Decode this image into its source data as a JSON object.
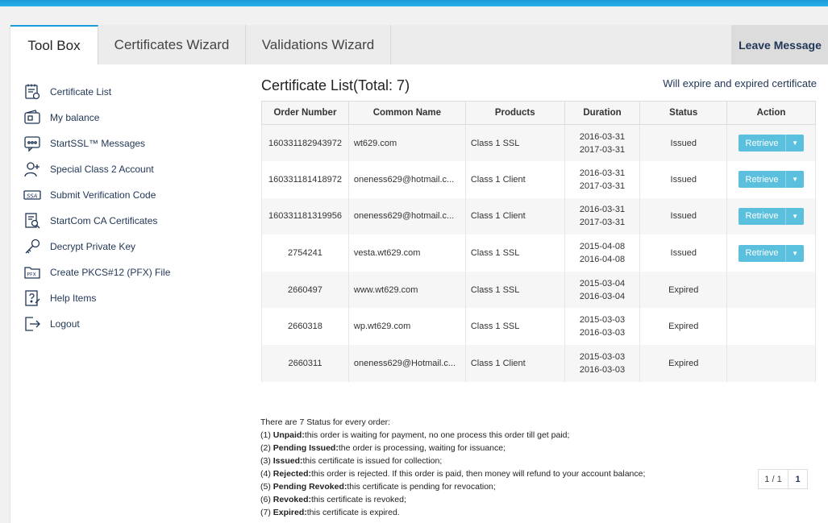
{
  "tabs": [
    {
      "label": "Tool Box"
    },
    {
      "label": "Certificates Wizard"
    },
    {
      "label": "Validations Wizard"
    }
  ],
  "leave_message": "Leave Message",
  "sidebar": {
    "items": [
      {
        "label": "Certificate List",
        "icon": "certificate-list-icon"
      },
      {
        "label": "My balance",
        "icon": "wallet-icon"
      },
      {
        "label": "StartSSL™ Messages",
        "icon": "message-icon"
      },
      {
        "label": "Special Class 2 Account",
        "icon": "add-user-icon"
      },
      {
        "label": "Submit Verification Code",
        "icon": "ssa-icon"
      },
      {
        "label": "StartCom CA Certificates",
        "icon": "ca-certificate-icon"
      },
      {
        "label": "Decrypt Private Key",
        "icon": "key-icon"
      },
      {
        "label": "Create PKCS#12 (PFX) File",
        "icon": "pfx-folder-icon"
      },
      {
        "label": "Help Items",
        "icon": "help-icon"
      },
      {
        "label": "Logout",
        "icon": "logout-icon"
      }
    ]
  },
  "main": {
    "title": "Certificate List(Total: 7)",
    "expire_link": "Will expire and expired certificate",
    "columns": [
      "Order Number",
      "Common Name",
      "Products",
      "Duration",
      "Status",
      "Action"
    ],
    "retrieve_label": "Retrieve",
    "rows": [
      {
        "order": "160331182943972",
        "cn": "wt629.com",
        "product": "Class 1 SSL",
        "start": "2016-03-31",
        "end": "2017-03-31",
        "status": "Issued",
        "action": true
      },
      {
        "order": "160331181418972",
        "cn": "oneness629@hotmail.c...",
        "product": "Class 1 Client",
        "start": "2016-03-31",
        "end": "2017-03-31",
        "status": "Issued",
        "action": true
      },
      {
        "order": "160331181319956",
        "cn": "oneness629@hotmail.c...",
        "product": "Class 1 Client",
        "start": "2016-03-31",
        "end": "2017-03-31",
        "status": "Issued",
        "action": true
      },
      {
        "order": "2754241",
        "cn": "vesta.wt629.com",
        "product": "Class 1 SSL",
        "start": "2015-04-08",
        "end": "2016-04-08",
        "status": "Issued",
        "action": true
      },
      {
        "order": "2660497",
        "cn": "www.wt629.com",
        "product": "Class 1 SSL",
        "start": "2015-03-04",
        "end": "2016-03-04",
        "status": "Expired",
        "action": false
      },
      {
        "order": "2660318",
        "cn": "wp.wt629.com",
        "product": "Class 1 SSL",
        "start": "2015-03-03",
        "end": "2016-03-03",
        "status": "Expired",
        "action": false
      },
      {
        "order": "2660311",
        "cn": "oneness629@Hotmail.c...",
        "product": "Class 1 Client",
        "start": "2015-03-03",
        "end": "2016-03-03",
        "status": "Expired",
        "action": false
      }
    ],
    "pager": {
      "info": "1 / 1",
      "current": "1"
    }
  },
  "notes": {
    "intro": "There are 7 Status for every order:",
    "items": [
      {
        "prefix": "(1) ",
        "term": "Unpaid:",
        "text": "this order is waiting for payment, no one process this order till get paid;"
      },
      {
        "prefix": "(2) ",
        "term": "Pending Issued:",
        "text": "the order is processing, waiting for issuance;"
      },
      {
        "prefix": "(3) ",
        "term": "Issued:",
        "text": "this certificate is issued for collection;"
      },
      {
        "prefix": "(4) ",
        "term": "Rejected:",
        "text": "this order is rejected. If this order is paid, then money will refund to your account balance;"
      },
      {
        "prefix": "(5) ",
        "term": "Pending Revoked:",
        "text": "this certificate is pending for revocation;"
      },
      {
        "prefix": "(6) ",
        "term": "Revoked:",
        "text": "this certificate is revoked;"
      },
      {
        "prefix": "(7) ",
        "term": "Expired:",
        "text": "this certificate is expired."
      }
    ]
  },
  "colors": {
    "accent": "#1a9ad8",
    "button": "#5bc0de",
    "nav_text": "#1f3555"
  }
}
